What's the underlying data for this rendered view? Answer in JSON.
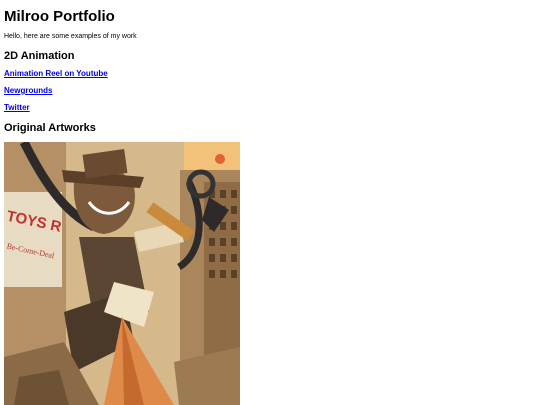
{
  "page": {
    "title": "Milroo Portfolio",
    "intro": "Hello, here are some examples of my work"
  },
  "sections": {
    "animation": {
      "heading": "2D Animation",
      "links": [
        {
          "label": "Animation Reel on Youtube"
        },
        {
          "label": "Newgrounds"
        },
        {
          "label": "Twitter"
        }
      ]
    },
    "artworks": {
      "heading": "Original Artworks",
      "image": {
        "sign_text_1": "TOYS R",
        "sign_text_2": "Be-Come-Deal"
      }
    }
  }
}
